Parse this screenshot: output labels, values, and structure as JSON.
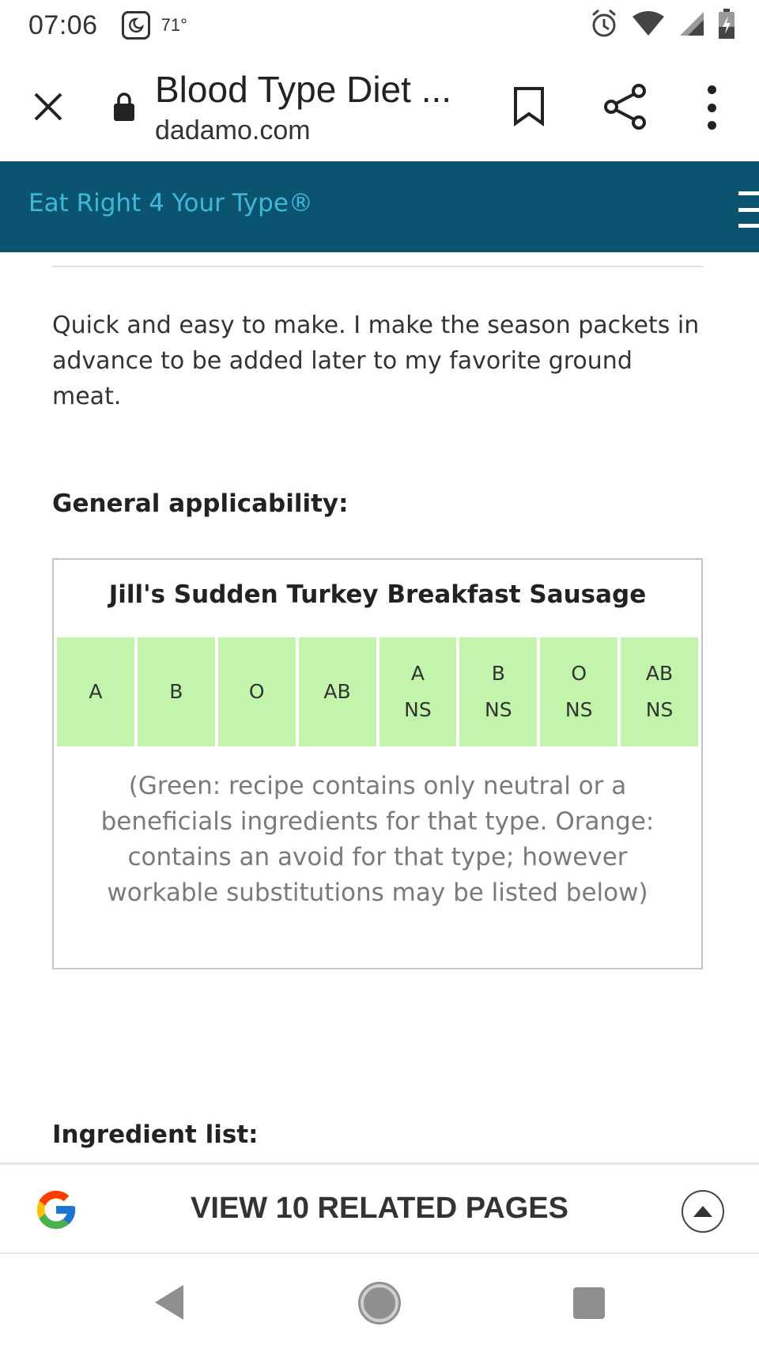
{
  "status_bar": {
    "time": "07:06",
    "temperature": "71°",
    "icons": [
      "dnd-icon",
      "alarm-icon",
      "wifi-icon",
      "signal-icon",
      "battery-charging-icon"
    ]
  },
  "browser": {
    "title": "Blood Type Diet ...",
    "url": "dadamo.com",
    "icons": [
      "close-icon",
      "lock-icon",
      "bookmark-icon",
      "share-icon",
      "more-vert-icon"
    ]
  },
  "site": {
    "brand": "Eat Right 4 Your Type®",
    "header_color": "#0b5470",
    "brand_color": "#3fb8d8",
    "menu_icon": "hamburger-icon"
  },
  "content": {
    "description": "Quick and easy to make. I make the season packets in advance to be added later to my favorite ground meat.",
    "general_heading": "General applicability:",
    "recipe_title": "Jill's Sudden Turkey Breakfast Sausage",
    "types": [
      {
        "line1": "A",
        "line2": ""
      },
      {
        "line1": "B",
        "line2": ""
      },
      {
        "line1": "O",
        "line2": ""
      },
      {
        "line1": "AB",
        "line2": ""
      },
      {
        "line1": "A",
        "line2": "NS"
      },
      {
        "line1": "B",
        "line2": "NS"
      },
      {
        "line1": "O",
        "line2": "NS"
      },
      {
        "line1": "AB",
        "line2": "NS"
      }
    ],
    "type_cell_color": "#c2f5ab",
    "legend": "(Green: recipe contains only neutral or a beneficials ingredients for that type. Orange: contains an avoid for that type; however workable substitutions may be listed below)",
    "ingredients_heading": "Ingredient list:"
  },
  "related": {
    "label": "VIEW 10 RELATED PAGES",
    "icons": [
      "google-logo-icon",
      "expand-up-icon"
    ]
  },
  "nav": {
    "icons": [
      "back-icon",
      "home-icon",
      "recents-icon"
    ]
  }
}
